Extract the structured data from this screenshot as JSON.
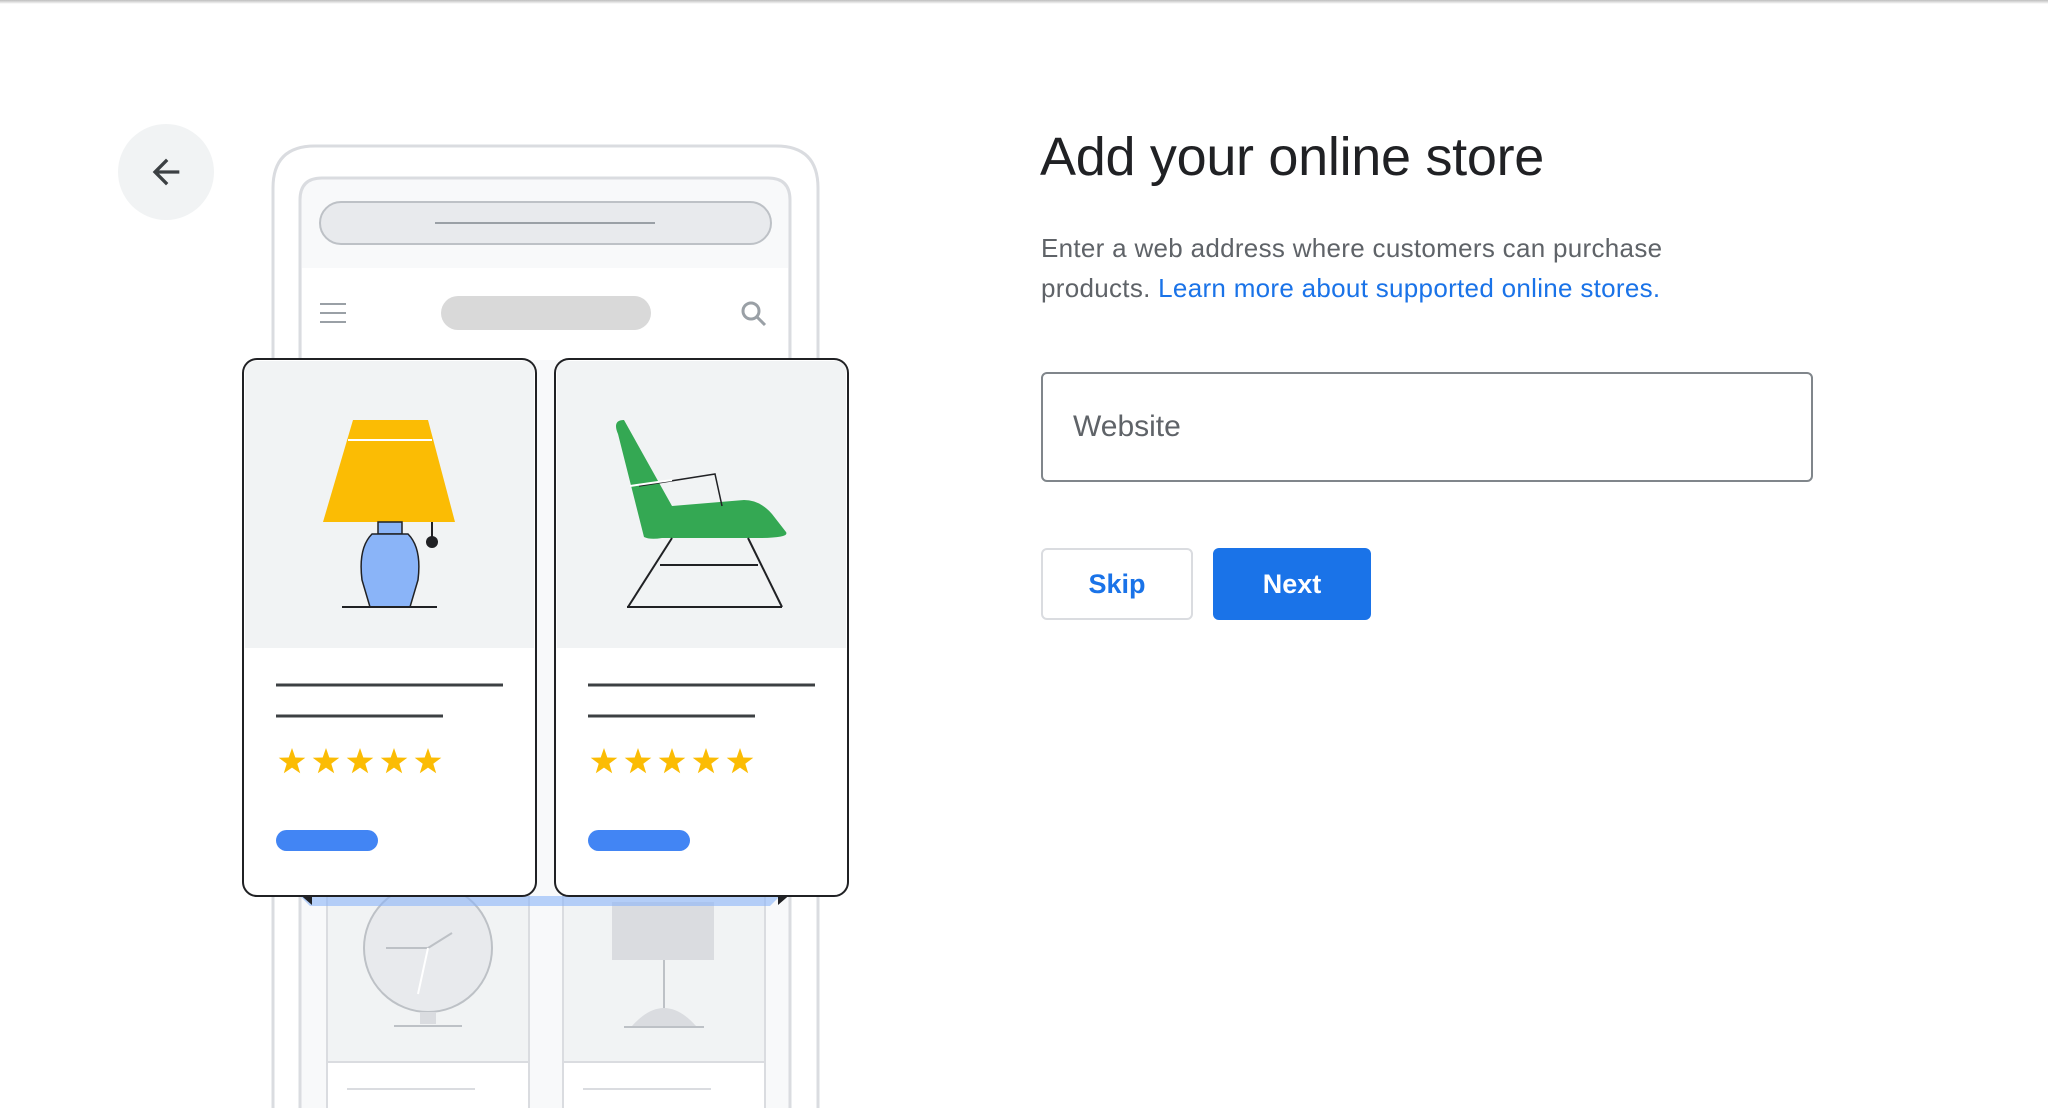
{
  "header": {
    "back_icon": "arrow-back-icon"
  },
  "main": {
    "title": "Add your online store",
    "description_text": "Enter a web address where customers can purchase products. ",
    "learn_more_link": "Learn more about supported online stores.",
    "website_field": {
      "placeholder": "Website",
      "value": ""
    },
    "skip_label": "Skip",
    "next_label": "Next"
  },
  "illustration": {
    "icons": [
      "menu-icon",
      "search-icon",
      "lamp-icon",
      "chair-icon",
      "clock-icon",
      "floor-lamp-icon",
      "star-icon"
    ],
    "product_rating_stars": 5
  },
  "colors": {
    "accent": "#1a73e8",
    "lamp_shade": "#fbbc04",
    "lamp_base": "#8ab4f8",
    "chair": "#34a853",
    "star": "#fbbc04",
    "title_text": "#202124",
    "body_text": "#5f6368"
  }
}
